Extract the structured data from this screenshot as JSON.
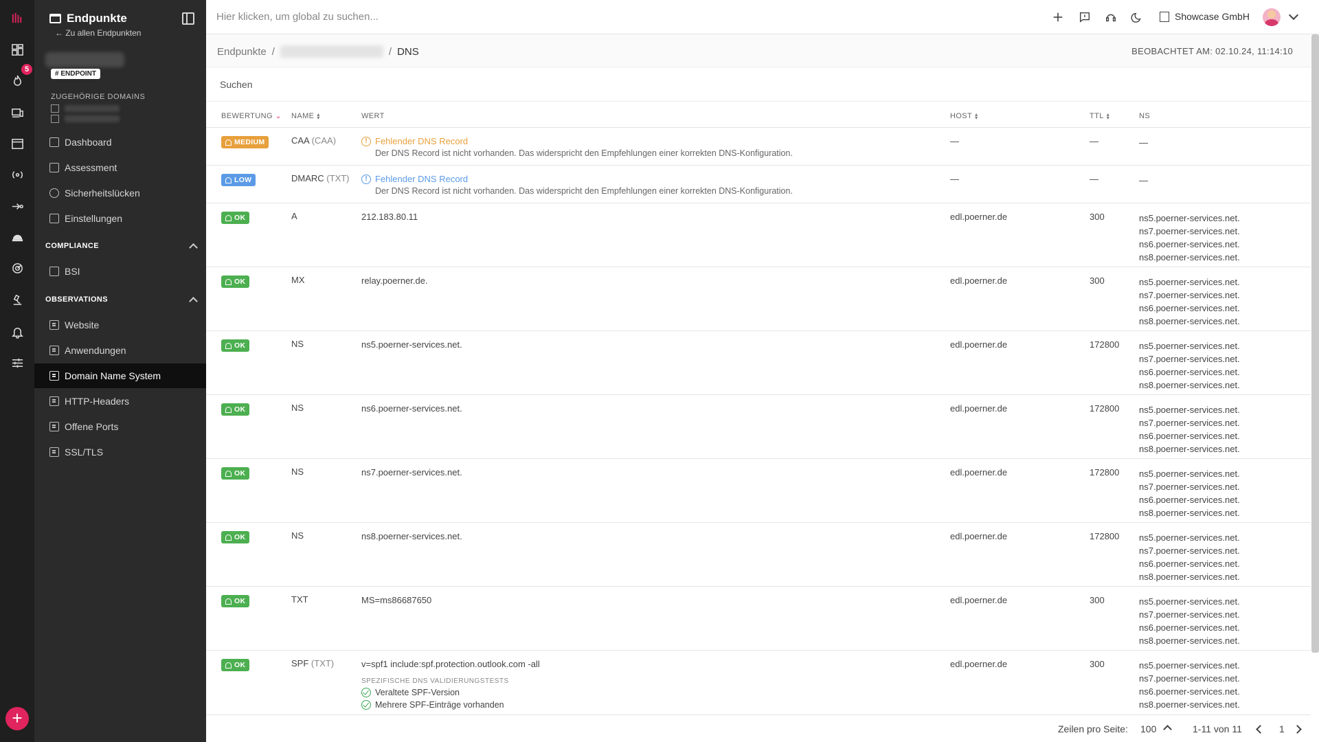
{
  "app": {
    "section_title": "Endpunkte",
    "back_link": "← Zu allen Endpunkten",
    "endpoint_tag": "# ENDPOINT",
    "related_domains_label": "ZUGEHÖRIGE DOMAINS",
    "rail_badge": "5",
    "fab_label": "+"
  },
  "sidebar": {
    "items_top": [
      {
        "label": "Dashboard"
      },
      {
        "label": "Assessment"
      },
      {
        "label": "Sicherheitslücken"
      },
      {
        "label": "Einstellungen"
      }
    ],
    "compliance_label": "COMPLIANCE",
    "compliance_items": [
      {
        "label": "BSI"
      }
    ],
    "observations_label": "OBSERVATIONS",
    "observation_items": [
      {
        "label": "Website"
      },
      {
        "label": "Anwendungen"
      },
      {
        "label": "Domain Name System",
        "active": true
      },
      {
        "label": "HTTP-Headers"
      },
      {
        "label": "Offene Ports"
      },
      {
        "label": "SSL/TLS"
      }
    ]
  },
  "topbar": {
    "search_placeholder": "Hier klicken, um global zu suchen...",
    "org_name": "Showcase GmbH"
  },
  "breadcrumb": {
    "root": "Endpunkte",
    "sep": "/",
    "current": "DNS",
    "observed": "BEOBACHTET AM: 02.10.24, 11:14:10"
  },
  "table": {
    "search_placeholder": "Suchen",
    "headers": {
      "rating": "BEWERTUNG",
      "name": "NAME",
      "value": "WERT",
      "host": "HOST",
      "ttl": "TTL",
      "ns": "NS"
    },
    "ns_list": [
      "ns5.poerner-services.net.",
      "ns7.poerner-services.net.",
      "ns6.poerner-services.net.",
      "ns8.poerner-services.net."
    ],
    "missing_title": "Fehlender DNS Record",
    "missing_desc": "Der DNS Record ist nicht vorhanden. Das widerspricht den Empfehlungen einer korrekten DNS-Konfiguration.",
    "dash": "—",
    "rows": [
      {
        "rating": "MEDIUM",
        "name": "CAA",
        "type": "(CAA)"
      },
      {
        "rating": "LOW",
        "name": "DMARC",
        "type": "(TXT)"
      },
      {
        "rating": "OK",
        "name": "A",
        "value": "212.183.80.11",
        "host": "edl.poerner.de",
        "ttl": "300"
      },
      {
        "rating": "OK",
        "name": "MX",
        "value": "relay.poerner.de.",
        "host": "edl.poerner.de",
        "ttl": "300"
      },
      {
        "rating": "OK",
        "name": "NS",
        "value": "ns5.poerner-services.net.",
        "host": "edl.poerner.de",
        "ttl": "172800"
      },
      {
        "rating": "OK",
        "name": "NS",
        "value": "ns6.poerner-services.net.",
        "host": "edl.poerner.de",
        "ttl": "172800"
      },
      {
        "rating": "OK",
        "name": "NS",
        "value": "ns7.poerner-services.net.",
        "host": "edl.poerner.de",
        "ttl": "172800"
      },
      {
        "rating": "OK",
        "name": "NS",
        "value": "ns8.poerner-services.net.",
        "host": "edl.poerner.de",
        "ttl": "172800"
      },
      {
        "rating": "OK",
        "name": "TXT",
        "value": "MS=ms86687650",
        "host": "edl.poerner.de",
        "ttl": "300"
      },
      {
        "rating": "OK",
        "name": "SPF",
        "type": "(TXT)",
        "value": "v=spf1 include:spf.protection.outlook.com -all",
        "host": "edl.poerner.de",
        "ttl": "300",
        "tests_label": "SPEZIFISCHE DNS VALIDIERUNGSTESTS",
        "tests": [
          "Veraltete SPF-Version",
          "Mehrere SPF-Einträge vorhanden"
        ]
      }
    ]
  },
  "footer": {
    "rows_per_page_label": "Zeilen pro Seite:",
    "rows_per_page": "100",
    "range": "1-11 von 11",
    "page": "1"
  },
  "colors": {
    "medium": "#e8a03c",
    "low": "#5b9be6",
    "ok": "#4caf50",
    "accent": "#e0245e"
  }
}
